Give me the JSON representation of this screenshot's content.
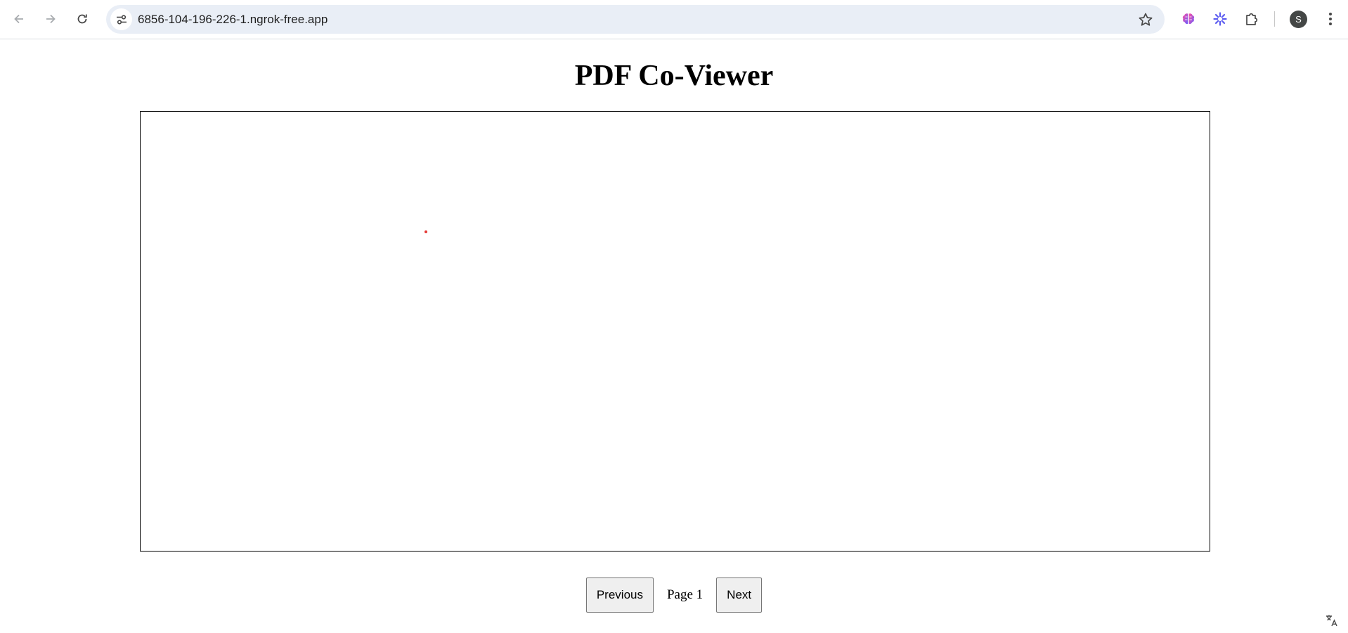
{
  "browser": {
    "url": "6856-104-196-226-1.ngrok-free.app",
    "profile_initial": "S",
    "icons": {
      "back": "arrow-left-icon",
      "forward": "arrow-right-icon",
      "reload": "reload-icon",
      "site_info": "tune-icon",
      "bookmark": "star-icon",
      "extension_1": "brain-icon",
      "extension_2": "sparkle-icon",
      "extensions": "puzzle-icon",
      "menu": "kebab-menu-icon",
      "translate": "translate-icon"
    },
    "colors": {
      "omnibox": "#e9eef6",
      "avatar": "#444746",
      "sparkle": "#5b5bf0"
    }
  },
  "page": {
    "title": "PDF Co-Viewer",
    "pager": {
      "previous_label": "Previous",
      "page_text": "Page 1",
      "next_label": "Next"
    },
    "cursor_color": "#e53935"
  }
}
